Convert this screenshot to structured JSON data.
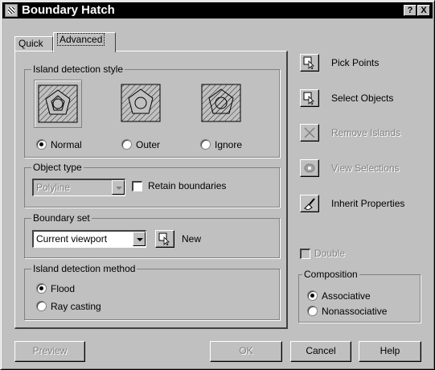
{
  "window": {
    "title": "Boundary Hatch",
    "help_glyph": "?",
    "close_glyph": "X"
  },
  "tabs": [
    {
      "label": "Quick"
    },
    {
      "label": "Advanced"
    }
  ],
  "island_detection_style": {
    "title": "Island detection style",
    "options": [
      {
        "label": "Normal",
        "selected": true
      },
      {
        "label": "Outer",
        "selected": false
      },
      {
        "label": "Ignore",
        "selected": false
      }
    ]
  },
  "object_type": {
    "title": "Object type",
    "value": "Polyline",
    "retain_label": "Retain boundaries"
  },
  "boundary_set": {
    "title": "Boundary set",
    "value": "Current viewport",
    "new_label": "New"
  },
  "island_detection_method": {
    "title": "Island detection method",
    "options": [
      {
        "label": "Flood",
        "selected": true
      },
      {
        "label": "Ray casting",
        "selected": false
      }
    ]
  },
  "actions": [
    {
      "label": "Pick Points",
      "icon": "pick-points-icon",
      "enabled": true
    },
    {
      "label": "Select Objects",
      "icon": "select-objects-icon",
      "enabled": true
    },
    {
      "label": "Remove Islands",
      "icon": "remove-islands-icon",
      "enabled": false
    },
    {
      "label": "View Selections",
      "icon": "view-selections-icon",
      "enabled": false
    },
    {
      "label": "Inherit Properties",
      "icon": "inherit-properties-icon",
      "enabled": true
    }
  ],
  "double": {
    "label": "Double",
    "enabled": false
  },
  "composition": {
    "title": "Composition",
    "options": [
      {
        "label": "Associative",
        "selected": true
      },
      {
        "label": "Nonassociative",
        "selected": false
      }
    ]
  },
  "footer": {
    "preview": "Preview",
    "ok": "OK",
    "cancel": "Cancel",
    "help": "Help"
  }
}
